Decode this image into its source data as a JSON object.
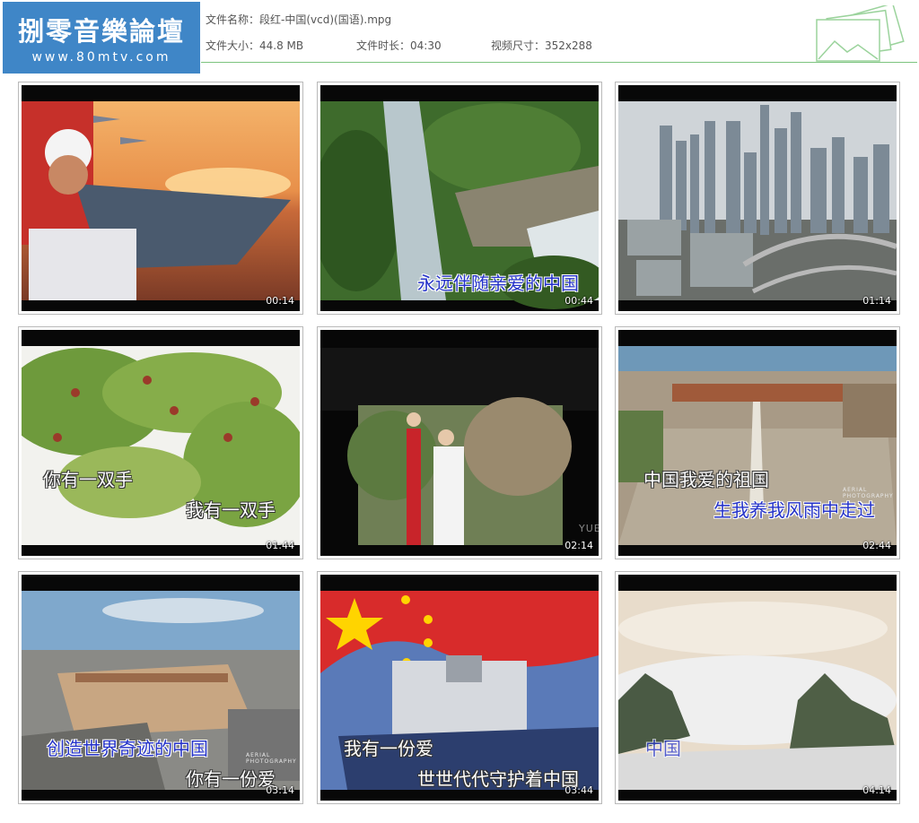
{
  "header": {
    "brand_main": "捌零音樂論壇",
    "brand_url": "www.80mtv.com",
    "file_name_label": "文件名称：",
    "file_name": "段红-中国(vcd)(国语).mpg",
    "file_size_label": "文件大小：",
    "file_size": "44.8 MB",
    "duration_label": "文件时长：",
    "duration": "04:30",
    "dimensions_label": "视频尺寸：",
    "dimensions": "352x288",
    "icon": "picture-stack-icon"
  },
  "thumbnails": [
    {
      "timestamp": "00:14",
      "subtitles": []
    },
    {
      "timestamp": "00:44",
      "subtitles": [
        "永远伴随亲爱的中国"
      ]
    },
    {
      "timestamp": "01:14",
      "subtitles": []
    },
    {
      "timestamp": "01:44",
      "subtitles": [
        "你有一双手",
        "我有一双手"
      ]
    },
    {
      "timestamp": "02:14",
      "subtitles": [],
      "watermark": "YUE"
    },
    {
      "timestamp": "02:44",
      "subtitles": [
        "中国我爱的祖国",
        "生我养我风雨中走过"
      ],
      "watermark": "AERIAL PHOTOGRAPHY"
    },
    {
      "timestamp": "03:14",
      "subtitles": [
        "创造世界奇迹的中国",
        "你有一份爱"
      ],
      "watermark": "AERIAL PHOTOGRAPHY"
    },
    {
      "timestamp": "03:44",
      "subtitles": [
        "我有一份爱",
        "世世代代守护着中国"
      ]
    },
    {
      "timestamp": "04:14",
      "subtitles": [
        "中国"
      ]
    }
  ],
  "colors": {
    "header_blue": "#3f86c7",
    "rule_green": "#7cc47f",
    "subtitle_blue": "#2432c8"
  }
}
